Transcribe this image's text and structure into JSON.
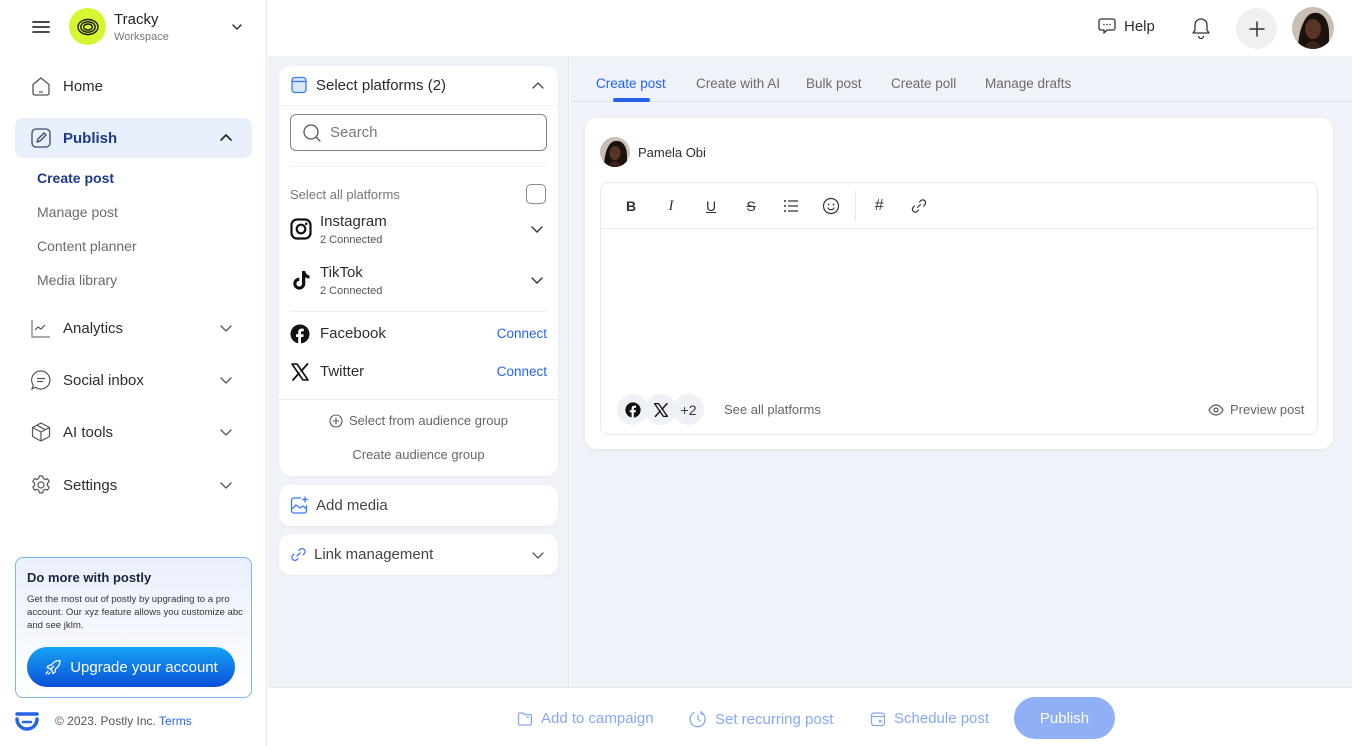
{
  "workspace": {
    "name": "Tracky",
    "subtitle": "Workspace",
    "logo_color": "#d7f531"
  },
  "sidebar": {
    "items": [
      {
        "id": "home",
        "label": "Home",
        "icon": "home-icon"
      },
      {
        "id": "publish",
        "label": "Publish",
        "icon": "edit-icon",
        "active": true,
        "expanded": true
      },
      {
        "id": "analytics",
        "label": "Analytics",
        "icon": "chart-icon"
      },
      {
        "id": "social-inbox",
        "label": "Social inbox",
        "icon": "chat-icon"
      },
      {
        "id": "ai-tools",
        "label": "AI tools",
        "icon": "box-icon"
      },
      {
        "id": "settings",
        "label": "Settings",
        "icon": "gear-icon"
      }
    ],
    "publish_sub": [
      {
        "label": "Create post",
        "active": true
      },
      {
        "label": "Manage post"
      },
      {
        "label": "Content planner"
      },
      {
        "label": "Media library"
      }
    ],
    "promo": {
      "title": "Do more with postly",
      "text": "Get the most out of postly by upgrading to a pro account. Our xyz feature allows you customize abc and see jklm.",
      "button": "Upgrade your account"
    },
    "footer": {
      "copyright": "© 2023. Postly Inc.",
      "terms": "Terms"
    }
  },
  "topbar": {
    "help": "Help"
  },
  "platforms": {
    "header": "Select platforms (2)",
    "search_placeholder": "Search",
    "select_all": "Select all platforms",
    "connected": [
      {
        "name": "Instagram",
        "status": "2 Connected"
      },
      {
        "name": "TikTok",
        "status": "2 Connected"
      }
    ],
    "unconnected": [
      {
        "name": "Facebook",
        "action": "Connect"
      },
      {
        "name": "Twitter",
        "action": "Connect"
      }
    ],
    "audience_select": "Select from audience group",
    "audience_create": "Create audience group"
  },
  "add_media": "Add media",
  "link_management": "Link management",
  "tabs": [
    {
      "label": "Create post",
      "active": true
    },
    {
      "label": "Create with AI"
    },
    {
      "label": "Bulk post"
    },
    {
      "label": "Create poll"
    },
    {
      "label": "Manage drafts"
    }
  ],
  "post": {
    "author": "Pamela Obi",
    "toolbar": [
      "bold",
      "italic",
      "underline",
      "strikethrough",
      "bullet-list",
      "emoji",
      "hashtag",
      "link"
    ],
    "toolbar_glyphs": {
      "bold": "B",
      "italic": "I",
      "underline": "U",
      "strikethrough": "S",
      "hashtag": "#"
    },
    "more_platforms": "+2",
    "see_all": "See all platforms",
    "preview": "Preview post"
  },
  "bottom": {
    "add_to_campaign": "Add to campaign",
    "recurring": "Set recurring post",
    "schedule": "Schedule post",
    "publish": "Publish"
  },
  "colors": {
    "accent": "#2563eb",
    "active_bg": "#e8effd",
    "publish_disabled": "#8fb0f6",
    "page_bg": "#eff2f9"
  }
}
